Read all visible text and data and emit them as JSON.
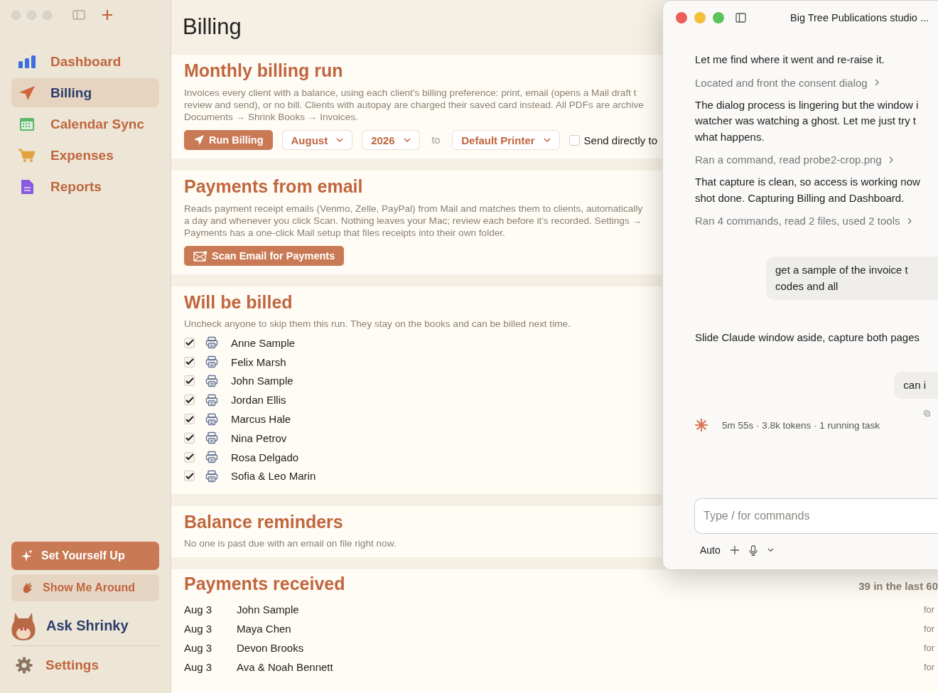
{
  "sidebar": {
    "nav": [
      {
        "label": "Dashboard",
        "selected": false
      },
      {
        "label": "Billing",
        "selected": true
      },
      {
        "label": "Calendar Sync",
        "selected": false
      },
      {
        "label": "Expenses",
        "selected": false
      },
      {
        "label": "Reports",
        "selected": false
      }
    ],
    "setup_button": "Set Yourself Up",
    "tour_button": "Show Me Around",
    "assistant": "Ask Shrinky",
    "settings": "Settings"
  },
  "page": {
    "title": "Billing",
    "billing_run": {
      "heading": "Monthly billing run",
      "description_lines": [
        "Invoices every client with a balance, using each client's billing preference: print, email (opens a Mail draft t",
        "review and send), or no bill. Clients with autopay are charged their saved card instead. All PDFs are archive",
        "Documents → Shrink Books → Invoices."
      ],
      "run_button": "Run Billing",
      "month": "August",
      "year": "2026",
      "to_label": "to",
      "printer": "Default Printer",
      "send_directly": {
        "label": "Send directly to",
        "checked": false
      }
    },
    "payments_from_email": {
      "heading": "Payments from email",
      "description_lines": [
        "Reads payment receipt emails (Venmo, Zelle, PayPal) from Mail and matches them to clients, automatically",
        "a day and whenever you click Scan. Nothing leaves your Mac; review each before it's recorded. Settings →",
        "Payments has a one-click Mail setup that files receipts into their own folder."
      ],
      "scan_button": "Scan Email for Payments"
    },
    "will_be_billed": {
      "heading": "Will be billed",
      "hint": "Uncheck anyone to skip them this run. They stay on the books and can be billed next time.",
      "clients": [
        {
          "name": "Anne Sample",
          "checked": true
        },
        {
          "name": "Felix Marsh",
          "checked": true
        },
        {
          "name": "John Sample",
          "checked": true
        },
        {
          "name": "Jordan Ellis",
          "checked": true
        },
        {
          "name": "Marcus Hale",
          "checked": true
        },
        {
          "name": "Nina Petrov",
          "checked": true
        },
        {
          "name": "Rosa Delgado",
          "checked": true
        },
        {
          "name": "Sofia & Leo Marin",
          "checked": true
        }
      ]
    },
    "balance_reminders": {
      "heading": "Balance reminders",
      "note": "No one is past due with an email on file right now."
    },
    "payments_received": {
      "heading": "Payments received",
      "summary": "39 in the last 60",
      "rows": [
        {
          "date": "Aug 3",
          "name": "John Sample",
          "column_3": "for"
        },
        {
          "date": "Aug 3",
          "name": "Maya Chen",
          "column_3": "for"
        },
        {
          "date": "Aug 3",
          "name": "Devon Brooks",
          "column_3": "for"
        },
        {
          "date": "Aug 3",
          "name": "Ava & Noah Bennett",
          "column_3": "for"
        }
      ]
    }
  },
  "chat_window": {
    "title": "Big Tree Publications studio ...",
    "messages": [
      {
        "kind": "assistant",
        "lines": [
          "Let me find where it went and re-raise it."
        ]
      },
      {
        "kind": "tool",
        "lines": [
          "Located and front the consent dialog"
        ]
      },
      {
        "kind": "assistant",
        "lines": [
          "The dialog process is lingering but the window i",
          "watcher was watching a ghost. Let me just try t",
          "what happens."
        ]
      },
      {
        "kind": "tool",
        "lines": [
          "Ran a command, read probe2-crop.png"
        ]
      },
      {
        "kind": "assistant",
        "lines": [
          "That capture is clean, so access is working now",
          "shot done. Capturing Billing and Dashboard."
        ]
      },
      {
        "kind": "tool",
        "lines": [
          "Ran 4 commands, read 2 files, used 2 tools"
        ]
      },
      {
        "kind": "user",
        "lines": [
          "get a sample of the invoice t",
          "codes and all"
        ]
      },
      {
        "kind": "assistant",
        "lines": [
          "Slide Claude window aside, capture both pages"
        ]
      },
      {
        "kind": "user",
        "lines": [
          "can i"
        ]
      }
    ],
    "status": "5m 55s · 3.8k tokens · 1 running task",
    "input": {
      "placeholder": "Type / for commands"
    },
    "mode": "Auto"
  }
}
